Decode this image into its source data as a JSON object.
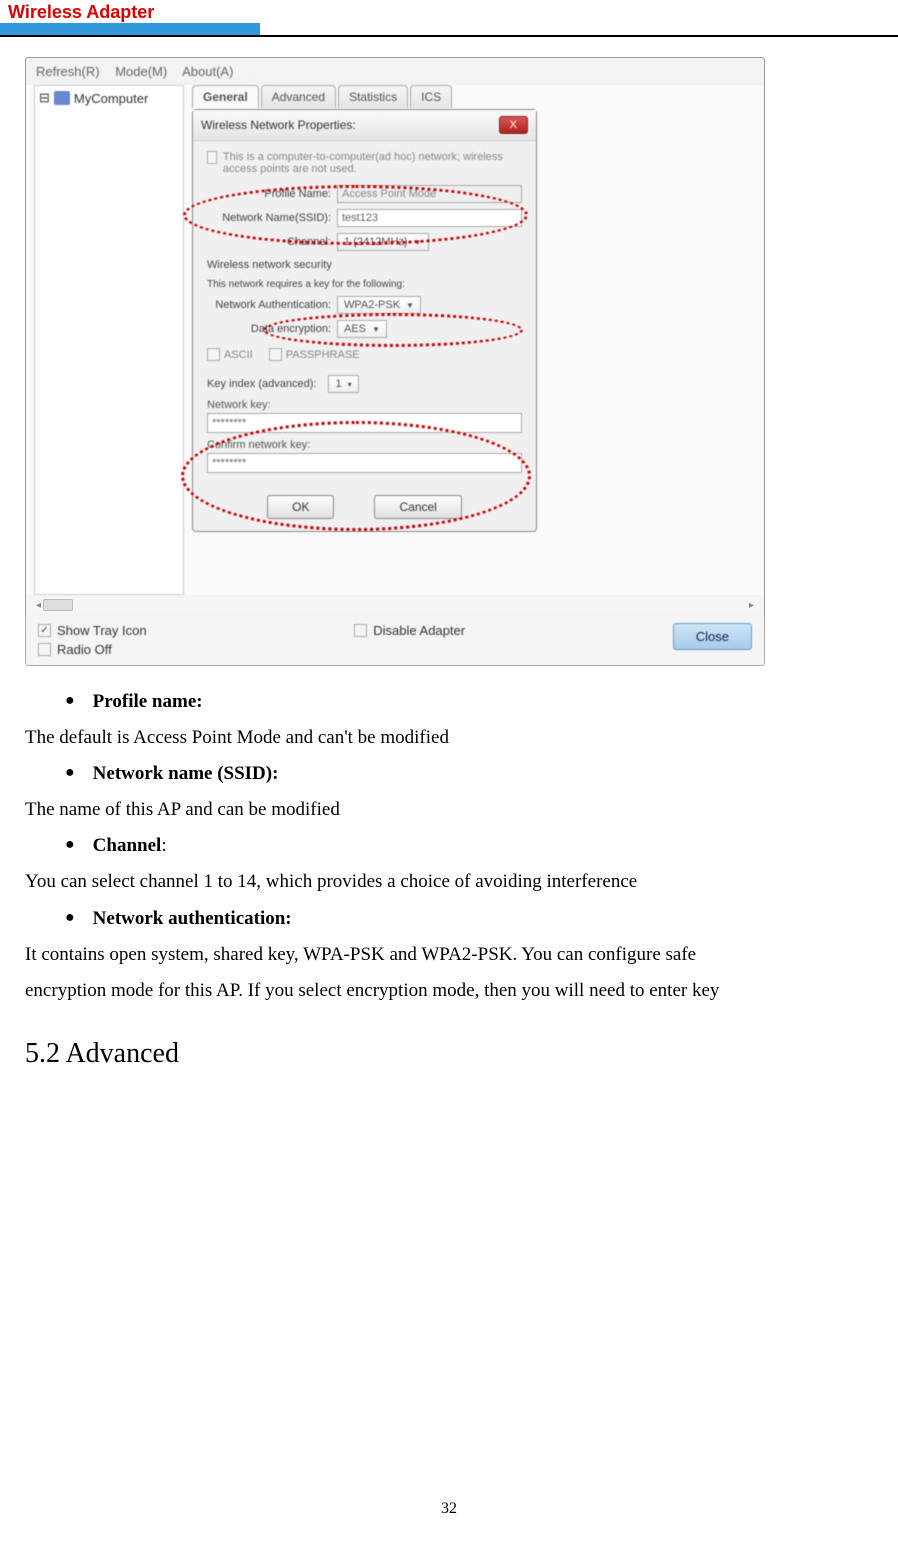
{
  "header": {
    "title": "Wireless  Adapter"
  },
  "menubar": {
    "refresh": "Refresh(R)",
    "mode": "Mode(M)",
    "about": "About(A)"
  },
  "tree": {
    "root": "MyComputer"
  },
  "tabs": {
    "general": "General",
    "advanced": "Advanced",
    "statistics": "Statistics",
    "ics": "ICS"
  },
  "dialog": {
    "title": "Wireless Network Properties:",
    "close_x": "X",
    "adhoc_note": "This is a computer-to-computer(ad hoc) network; wireless access points are not used.",
    "profile_label": "Profile Name:",
    "profile_value": "Access Point Mode",
    "ssid_label": "Network Name(SSID):",
    "ssid_value": "test123",
    "channel_label": "Channel:",
    "channel_value": "1 (2412MHz)",
    "security_heading": "Wireless network security",
    "security_note": "This network requires a key for the following:",
    "auth_label": "Network Authentication:",
    "auth_value": "WPA2-PSK",
    "encrypt_label": "Data encryption:",
    "encrypt_value": "AES",
    "ascii": "ASCII",
    "passphrase": "PASSPHRASE",
    "keyindex_label": "Key index (advanced):",
    "keyindex_value": "1",
    "netkey_label": "Network key:",
    "netkey_value": "********",
    "confirm_label": "Confirm network key:",
    "confirm_value": "********",
    "ok": "OK",
    "cancel": "Cancel"
  },
  "bottom": {
    "show_tray": "Show Tray Icon",
    "radio_off": "Radio Off",
    "disable_adapter": "Disable Adapter",
    "close": "Close"
  },
  "doc": {
    "b1": "Profile name:",
    "p1": "The default is Access Point Mode and can't be modified",
    "b2": "Network name (SSID):",
    "p2": "The name of this AP and can be modified",
    "b3": "Channel",
    "b3_colon": ":",
    "p3": "You can select channel 1 to 14, which provides a choice of avoiding interference",
    "b4": "Network authentication:",
    "p4a": "It contains open system, shared key, WPA-PSK and WPA2-PSK. You can configure safe",
    "p4b": "encryption mode for this AP. If you select encryption mode, then you will need to enter key",
    "heading": "5.2    Advanced",
    "pagenum": "32"
  }
}
